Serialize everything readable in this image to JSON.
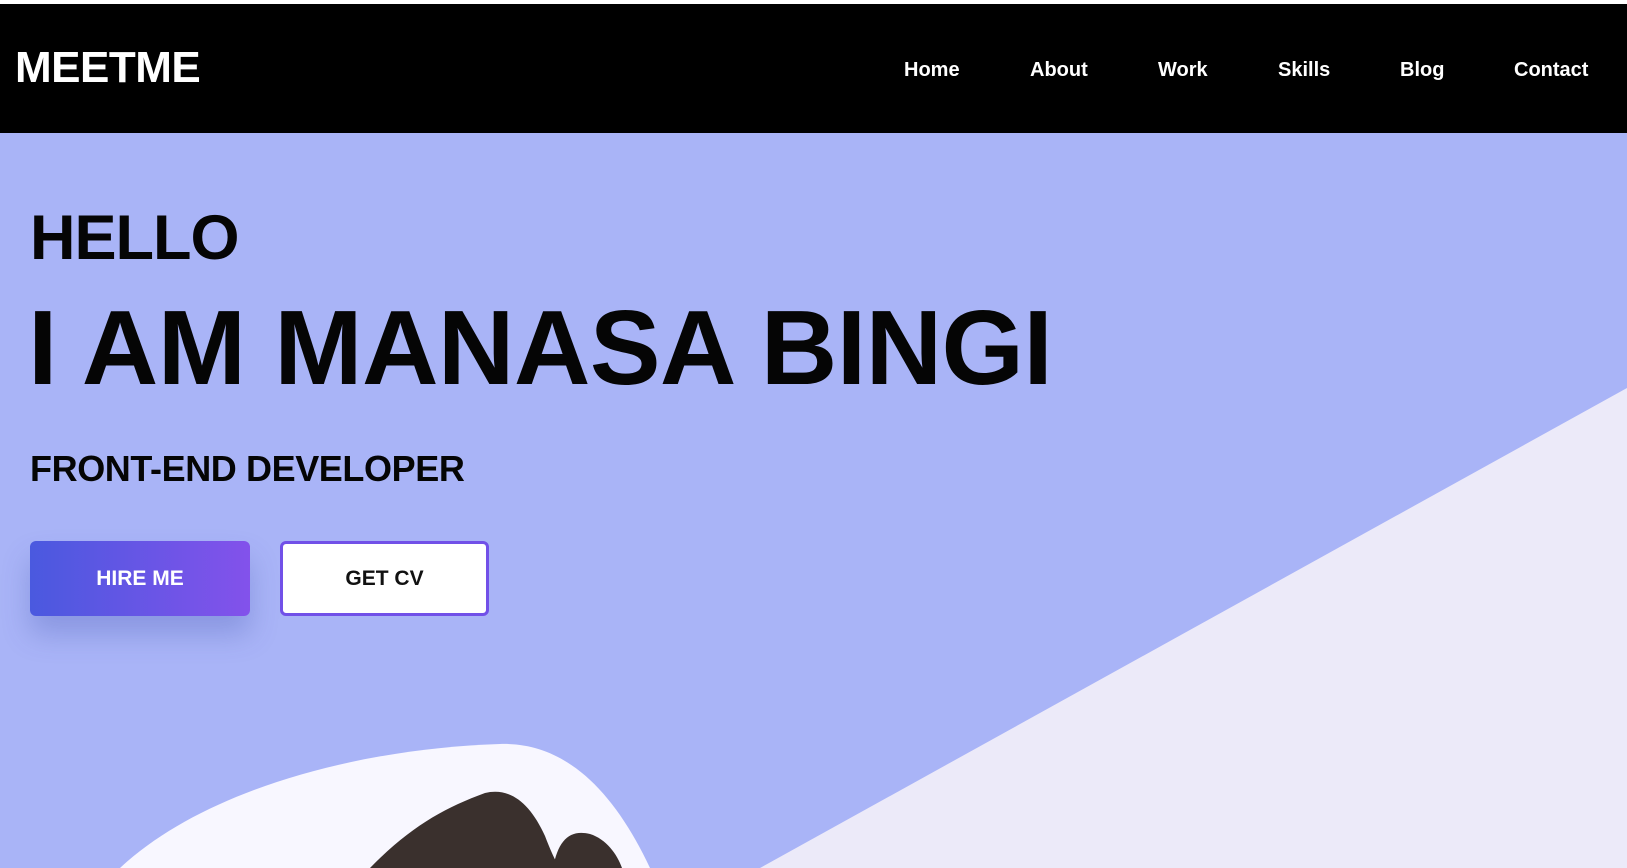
{
  "navbar": {
    "logo": "MEETME",
    "links": [
      {
        "label": "Home"
      },
      {
        "label": "About"
      },
      {
        "label": "Work"
      },
      {
        "label": "Skills"
      },
      {
        "label": "Blog"
      },
      {
        "label": "Contact"
      }
    ]
  },
  "hero": {
    "greeting": "HELLO",
    "name": "I AM MANASA BINGI",
    "role": "FRONT-END DEVELOPER",
    "buttons": {
      "hire": "HIRE ME",
      "cv": "GET CV"
    },
    "colors": {
      "background": "#a9b4f7",
      "accent_start": "#4a59df",
      "accent_end": "#8352eb",
      "diagonal_panel": "#eceaf9",
      "illustration_dark": "#3a302d"
    }
  }
}
